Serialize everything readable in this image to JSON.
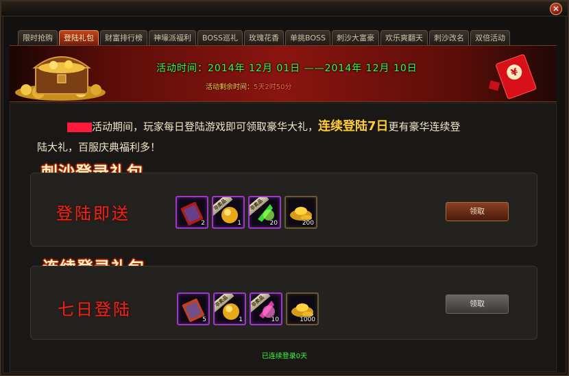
{
  "window": {
    "close_glyph": "✕"
  },
  "tabs": [
    {
      "label": "限时抢购",
      "active": false
    },
    {
      "label": "登陆礼包",
      "active": true
    },
    {
      "label": "财富排行榜",
      "active": false
    },
    {
      "label": "神壕派福利",
      "active": false
    },
    {
      "label": "BOSS巡礼",
      "active": false
    },
    {
      "label": "玫瑰花香",
      "active": false
    },
    {
      "label": "单挑BOSS",
      "active": false
    },
    {
      "label": "刺沙大富豪",
      "active": false
    },
    {
      "label": "欢乐爽翻天",
      "active": false
    },
    {
      "label": "刺沙改名",
      "active": false
    },
    {
      "label": "双倍活动",
      "active": false
    }
  ],
  "banner": {
    "time": "活动时间：2014年 12月 01日 ——2014年 12月 10日",
    "remain_label": "活动剩余时间：",
    "remain_value": "5天2时50分"
  },
  "intro": {
    "text1": "活动期间，玩家每日登陆游戏即可领取豪华大礼，",
    "highlight": "连续登陆7日",
    "text2": "更有豪华连续登",
    "line2": "陆大礼，百服庆典福利多！"
  },
  "section1": {
    "title": "刺沙登录礼包",
    "label": "登陆即送",
    "button": "领取",
    "items": [
      {
        "icon": "scroll-item-icon",
        "qty": "2",
        "ribbon": ""
      },
      {
        "icon": "gold-orb-item-icon",
        "qty": "1",
        "ribbon": "非卖品"
      },
      {
        "icon": "green-gem-item-icon",
        "qty": "20",
        "ribbon": "非卖品"
      },
      {
        "icon": "gold-ingot-item-icon",
        "qty": "200",
        "ribbon": ""
      }
    ]
  },
  "section2": {
    "title": "连续登录礼包",
    "label": "七日登陆",
    "button": "领取",
    "items": [
      {
        "icon": "scroll-item-icon",
        "qty": "5",
        "ribbon": ""
      },
      {
        "icon": "gold-orb-item-icon",
        "qty": "1",
        "ribbon": "非卖品"
      },
      {
        "icon": "pink-gem-item-icon",
        "qty": "10",
        "ribbon": "非卖品"
      },
      {
        "icon": "gold-ingot-item-icon",
        "qty": "1000",
        "ribbon": ""
      }
    ]
  },
  "footer": {
    "status": "已连续登录0天"
  },
  "colors": {
    "accent_green": "#3cff3c",
    "accent_gold": "#ffcc33",
    "label_red": "#e8261a",
    "active_tab": "#c2431e"
  }
}
